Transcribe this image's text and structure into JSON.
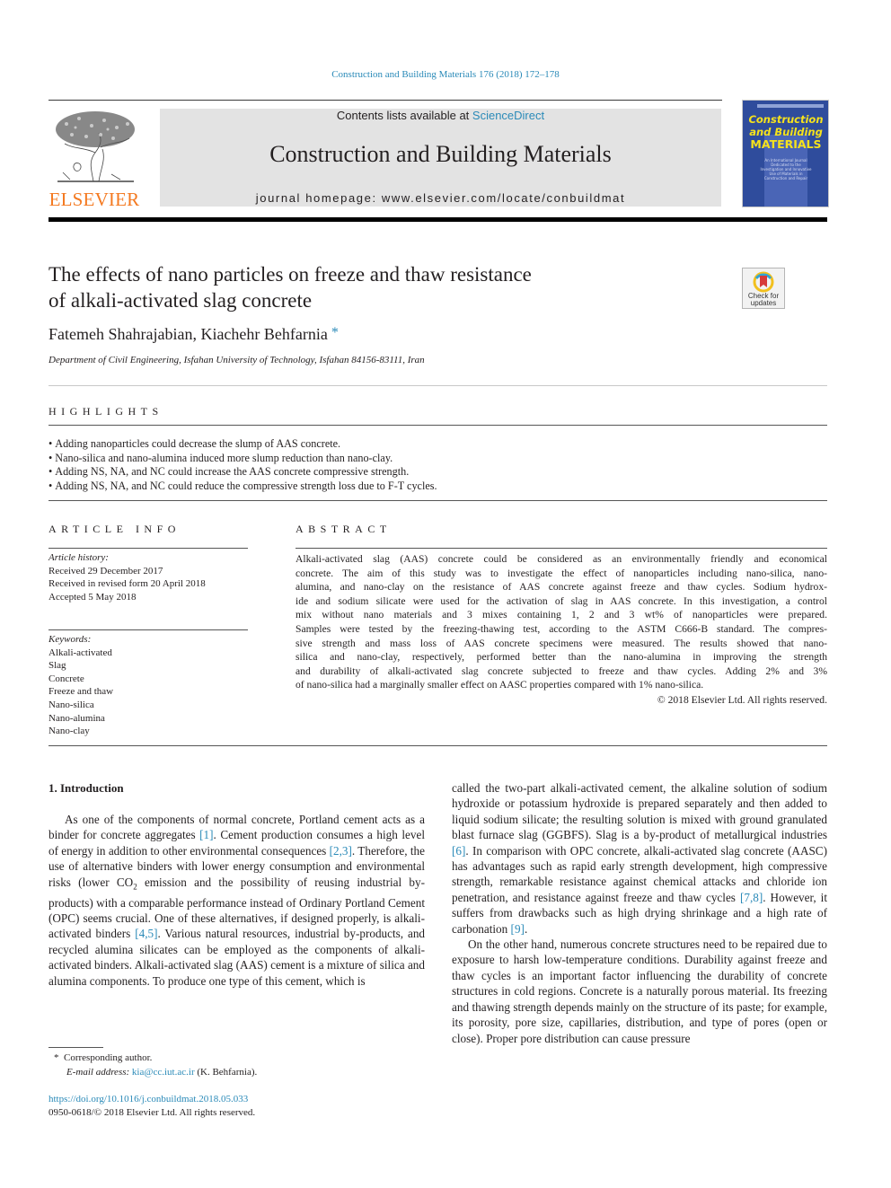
{
  "header": {
    "running_head": "Construction and Building Materials 176 (2018) 172–178",
    "publisher_logo_word": "ELSEVIER",
    "contents_prefix": "Contents lists available at ",
    "contents_link": "ScienceDirect",
    "journal_name": "Construction and Building Materials",
    "homepage": "journal homepage: www.elsevier.com/locate/conbuildmat",
    "cover": {
      "line1": "Construction",
      "line2": "and Building",
      "line3": "MATERIALS",
      "sub": "An International Journal Dedicated to the Investigation and Innovative Use of Materials in Construction and Repair",
      "title_color": "#f6e21c",
      "bg_color": "#2f4c9c"
    },
    "check_updates": "Check for updates"
  },
  "article": {
    "title_line1": "The effects of nano particles on freeze and thaw resistance",
    "title_line2": "of alkali-activated slag concrete",
    "authors": "Fatemeh Shahrajabian, Kiachehr Behfarnia",
    "corresponding_mark": "*",
    "affiliation": "Department of Civil Engineering, Isfahan University of Technology, Isfahan 84156-83111, Iran"
  },
  "highlights": {
    "heading": "HIGHLIGHTS",
    "items": [
      "Adding nanoparticles could decrease the slump of AAS concrete.",
      "Nano-silica and nano-alumina induced more slump reduction than nano-clay.",
      "Adding NS, NA, and NC could increase the AAS concrete compressive strength.",
      "Adding NS, NA, and NC could reduce the compressive strength loss due to F-T cycles."
    ]
  },
  "article_info": {
    "heading": "ARTICLE INFO",
    "history_label": "Article history:",
    "history": [
      "Received 29 December 2017",
      "Received in revised form 20 April 2018",
      "Accepted 5 May 2018"
    ],
    "keywords_label": "Keywords:",
    "keywords": [
      "Alkali-activated",
      "Slag",
      "Concrete",
      "Freeze and thaw",
      "Nano-silica",
      "Nano-alumina",
      "Nano-clay"
    ]
  },
  "abstract": {
    "heading": "ABSTRACT",
    "lines": [
      "Alkali-activated slag (AAS) concrete could be considered as an environmentally friendly and economical",
      "concrete. The aim of this study was to investigate the effect of nanoparticles including nano-silica, nano-",
      "alumina, and nano-clay on the resistance of AAS concrete against freeze and thaw cycles. Sodium hydrox-",
      "ide and sodium silicate were used for the activation of slag in AAS concrete. In this investigation, a control",
      "mix without nano materials and 3 mixes containing 1, 2 and 3 wt% of nanoparticles were prepared.",
      "Samples were tested by the freezing-thawing test, according to the ASTM C666-B standard. The compres-",
      "sive strength and mass loss of AAS concrete specimens were measured. The results showed that nano-",
      "silica and nano-clay, respectively, performed better than the nano-alumina in improving the strength",
      "and durability of alkali-activated slag concrete subjected to freeze and thaw cycles. Adding 2% and 3%",
      "of nano-silica had a marginally smaller effect on AASC properties compared with 1% nano-silica."
    ],
    "copyright": "© 2018 Elsevier Ltd. All rights reserved."
  },
  "introduction": {
    "heading": "1. Introduction",
    "col1": {
      "p1_a": "As one of the components of normal concrete, Portland cement acts as a binder for concrete aggregates ",
      "ref1": "[1]",
      "p1_b": ". Cement production consumes a high level of energy in addition to other environmental consequences ",
      "ref2": "[2,3]",
      "p1_c": ". Therefore, the use of alternative binders with lower energy consumption and environmental risks (lower CO",
      "sub2": "2",
      "p1_d": " emission and the possibility of reusing industrial by-products) with a comparable performance instead of Ordinary Portland Cement (OPC) seems crucial. One of these alternatives, if designed properly, is alkali-activated binders ",
      "ref3": "[4,5]",
      "p1_e": ". Various natural resources, industrial by-products, and recycled alumina silicates can be employed as the components of alkali-activated binders. Alkali-activated slag (AAS) cement is a mixture of silica and alumina components. To produce one type of this cement, which is"
    },
    "col2": {
      "p1_a": "called the two-part alkali-activated cement, the alkaline solution of sodium hydroxide or potassium hydroxide is prepared separately and then added to liquid sodium silicate; the resulting solution is mixed with ground granulated blast furnace slag (GGBFS). Slag is a by-product of metallurgical industries ",
      "ref1": "[6]",
      "p1_b": ". In comparison with OPC concrete, alkali-activated slag concrete (AASC) has advantages such as rapid early strength development, high compressive strength, remarkable resistance against chemical attacks and chloride ion penetration, and resistance against freeze and thaw cycles ",
      "ref2": "[7,8]",
      "p1_c": ". However, it suffers from drawbacks such as high drying shrinkage and a high rate of carbonation ",
      "ref3": "[9]",
      "p1_d": ".",
      "p2": "On the other hand, numerous concrete structures need to be repaired due to exposure to harsh low-temperature conditions. Durability against freeze and thaw cycles is an important factor influencing the durability of concrete structures in cold regions. Concrete is a naturally porous material. Its freezing and thawing strength depends mainly on the structure of its paste; for example, its porosity, pore size, capillaries, distribution, and type of pores (open or close). Proper pore distribution can cause pressure"
    }
  },
  "footnote": {
    "mark": "*",
    "corresponding": "Corresponding author.",
    "email_label": "E-mail address: ",
    "email": "kia@cc.iut.ac.ir",
    "email_suffix": " (K. Behfarnia).",
    "doi": "https://doi.org/10.1016/j.conbuildmat.2018.05.033",
    "issn_line": "0950-0618/© 2018 Elsevier Ltd. All rights reserved."
  }
}
